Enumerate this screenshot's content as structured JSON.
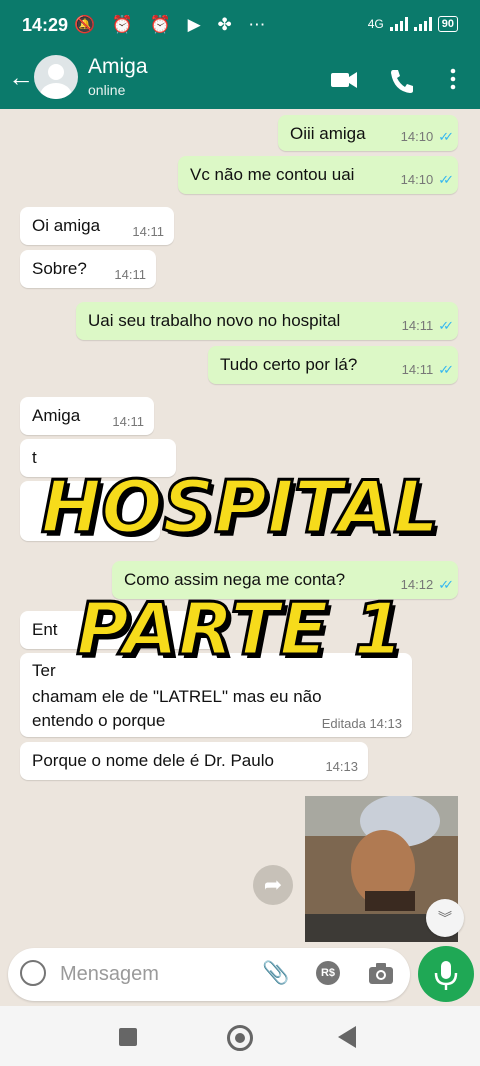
{
  "status_bar": {
    "time": "14:29",
    "status_icons": "🔕 ⏰ ⏰ ▶ ✤ ⋯",
    "network": "4G",
    "battery": "90"
  },
  "header": {
    "contact_name": "Amiga",
    "contact_status": "online"
  },
  "messages": [
    {
      "dir": "out",
      "text": "Oiii amiga",
      "time": "14:10"
    },
    {
      "dir": "out",
      "text": "Vc não me contou uai",
      "time": "14:10"
    },
    {
      "dir": "in",
      "text": "Oi amiga",
      "time": "14:11"
    },
    {
      "dir": "in",
      "text": "Sobre?",
      "time": "14:11"
    },
    {
      "dir": "out",
      "text": "Uai seu trabalho novo no hospital",
      "time": "14:11"
    },
    {
      "dir": "out",
      "text": "Tudo certo por lá?",
      "time": "14:11"
    },
    {
      "dir": "in",
      "text": "Amiga",
      "time": "14:11"
    },
    {
      "dir": "in",
      "text": "t",
      "time": ""
    },
    {
      "dir": "out",
      "text": "Como assim nega me conta?",
      "time": "14:12"
    },
    {
      "dir": "in",
      "text": "Ent",
      "time": ""
    },
    {
      "dir": "in",
      "text_lines": [
        "Ter",
        "chamam ele de \"LATREL\" mas eu não",
        "entendo o porque"
      ],
      "edited": "Editada",
      "time": "14:13"
    },
    {
      "dir": "in",
      "text": "Porque o nome dele é Dr. Paulo",
      "time": "14:13"
    }
  ],
  "overlay": {
    "line1": "HOSPITAL",
    "line2": "PARTE 1"
  },
  "input": {
    "placeholder": "Mensagem",
    "currency_badge": "R$"
  },
  "colors": {
    "header": "#0b7a6b",
    "outgoing_bubble": "#dcf8c6",
    "incoming_bubble": "#ffffff",
    "overlay_text": "#f6db1b",
    "mic_button": "#1fa855",
    "read_ticks": "#34b7f1"
  }
}
